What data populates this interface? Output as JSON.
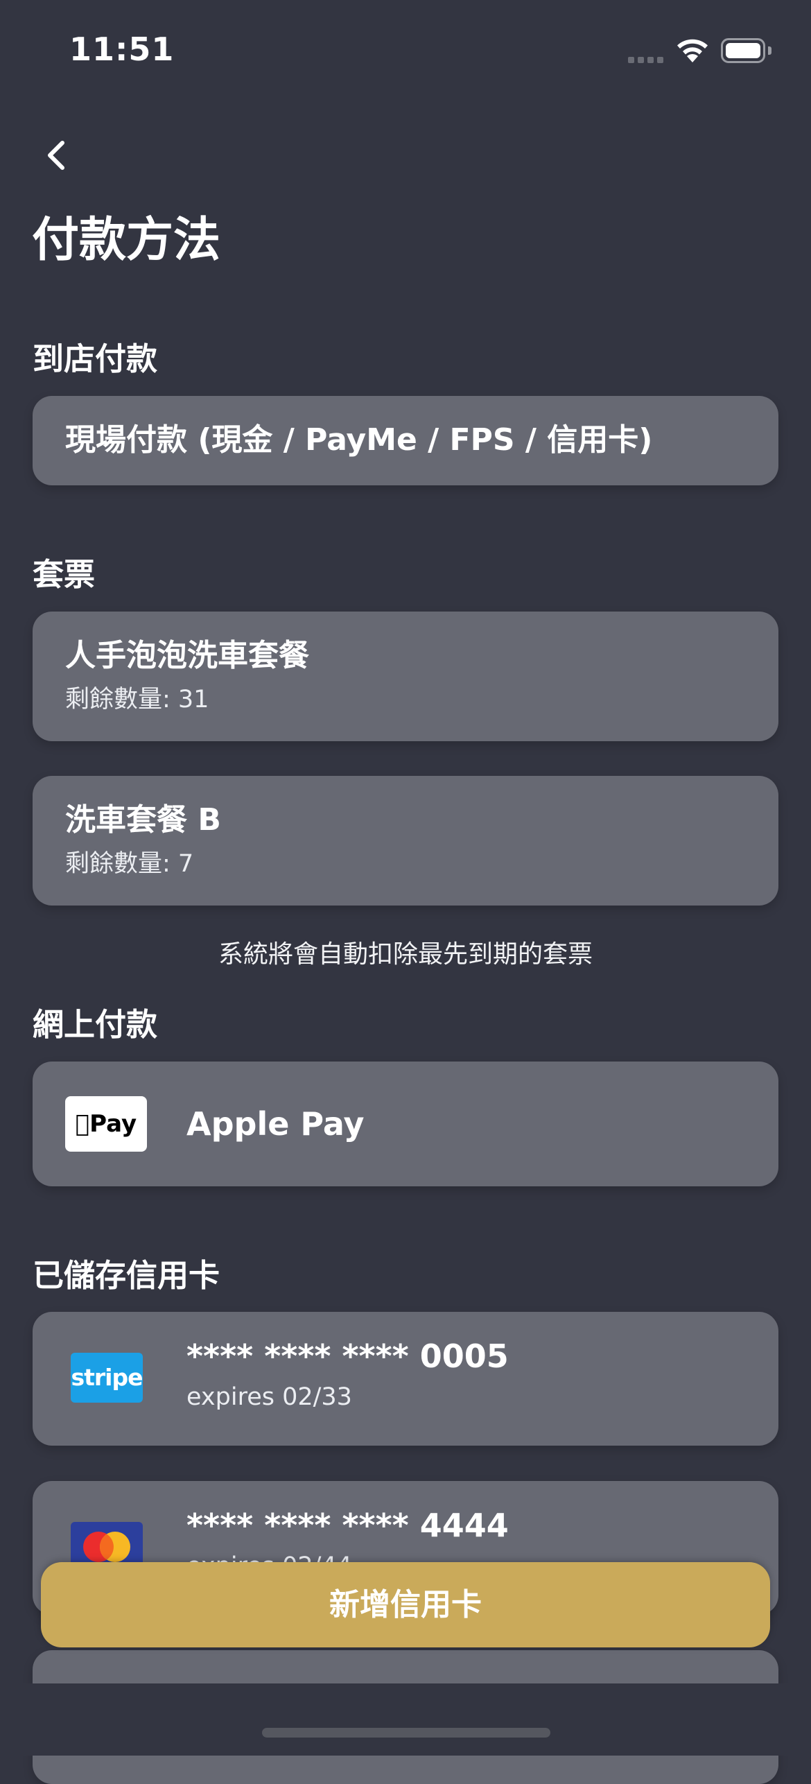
{
  "status_bar": {
    "time": "11:51"
  },
  "header": {
    "title": "付款方法"
  },
  "in_store": {
    "section_title": "到店付款",
    "option_label": "現場付款 (現金 / PayMe / FPS / 信用卡)"
  },
  "tickets": {
    "section_title": "套票",
    "items": [
      {
        "name": "人手泡泡洗車套餐",
        "remaining": "剩餘數量: 31"
      },
      {
        "name": "洗車套餐 B",
        "remaining": "剩餘數量: 7"
      }
    ],
    "note": "系統將會自動扣除最先到期的套票"
  },
  "online": {
    "section_title": "網上付款",
    "apple_pay_logo": "Pay",
    "apple_pay_label": "Apple Pay"
  },
  "saved_cards": {
    "section_title": "已儲存信用卡",
    "cards": [
      {
        "brand": "stripe",
        "logo_text": "stripe",
        "number": "**** **** **** 0005",
        "expiry": "expires 02/33"
      },
      {
        "brand": "mastercard-icon",
        "number": "**** **** **** 4444",
        "expiry": "expires 02/44"
      }
    ]
  },
  "actions": {
    "add_card_label": "新增信用卡"
  },
  "colors": {
    "background": "#333541",
    "card": "#676973",
    "accent_button": "#caaa5a",
    "stripe_blue": "#1ba0e6"
  }
}
